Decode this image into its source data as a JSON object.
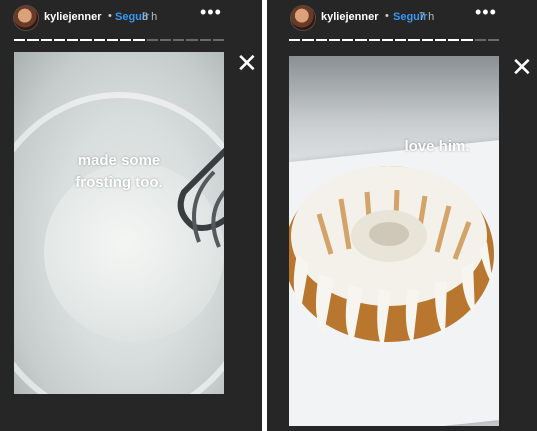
{
  "stories": [
    {
      "username": "kyliejenner",
      "separator": "•",
      "follow_label": "Seguir",
      "time": "8 h",
      "more_icon": "•••",
      "close_icon": "✕",
      "caption": "made some\nfrosting too."
    },
    {
      "username": "kyliejenner",
      "separator": "•",
      "follow_label": "Seguir",
      "time": "7 h",
      "more_icon": "•••",
      "close_icon": "✕",
      "caption": "love him."
    }
  ],
  "colors": {
    "background": "#262626",
    "follow": "#3897f0",
    "progress_active": "#ffffff",
    "progress_inactive": "#6a6a6a"
  },
  "icons": [
    "avatar",
    "more-icon",
    "close-icon"
  ]
}
